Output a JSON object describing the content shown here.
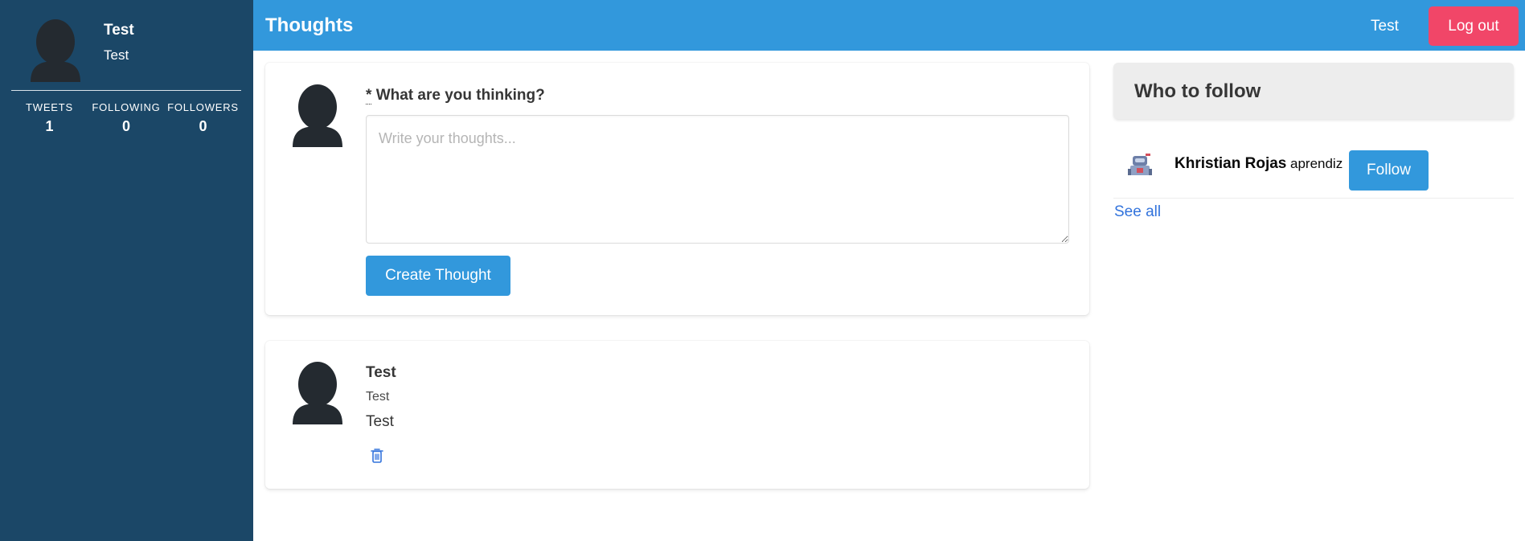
{
  "sidebar": {
    "profile": {
      "name": "Test",
      "handle": "Test",
      "avatar_icon": "user-silhouette-icon"
    },
    "stats": [
      {
        "label": "TWEETS",
        "value": "1"
      },
      {
        "label": "FOLLOWING",
        "value": "0"
      },
      {
        "label": "FOLLOWERS",
        "value": "0"
      }
    ]
  },
  "navbar": {
    "brand": "Thoughts",
    "user": "Test",
    "logout_label": "Log out"
  },
  "composer": {
    "required_marker": "*",
    "label": "What are you thinking?",
    "placeholder": "Write your thoughts...",
    "value": "",
    "submit_label": "Create Thought"
  },
  "posts": [
    {
      "name": "Test",
      "handle": "Test",
      "body": "Test",
      "delete_icon": "trash-icon"
    }
  ],
  "who_to_follow": {
    "title": "Who to follow",
    "items": [
      {
        "name": "Khristian Rojas",
        "handle": "aprendiz",
        "follow_label": "Follow",
        "avatar_icon": "robot-avatar-icon"
      }
    ],
    "see_all_label": "See all"
  },
  "colors": {
    "sidebar_bg": "#1b4767",
    "primary": "#3298dc",
    "danger": "#f14668",
    "link": "#3273dc"
  }
}
